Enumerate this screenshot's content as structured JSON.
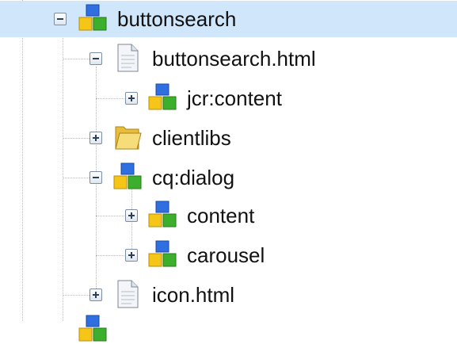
{
  "tree": {
    "nodes": [
      {
        "label": "buttonsearch",
        "icon": "node-icon",
        "expander": "collapse",
        "selected": true
      },
      {
        "label": "buttonsearch.html",
        "icon": "file-icon",
        "expander": "collapse"
      },
      {
        "label": "jcr:content",
        "icon": "node-icon",
        "expander": "expand"
      },
      {
        "label": "clientlibs",
        "icon": "folder-icon",
        "expander": "expand"
      },
      {
        "label": "cq:dialog",
        "icon": "node-icon",
        "expander": "collapse"
      },
      {
        "label": "content",
        "icon": "node-icon",
        "expander": "expand"
      },
      {
        "label": "carousel",
        "icon": "node-icon",
        "expander": "expand"
      },
      {
        "label": "icon.html",
        "icon": "file-icon",
        "expander": "expand"
      }
    ]
  },
  "colors": {
    "selection": "#cfe6fb",
    "guide_lines": "#b9b9b9",
    "cube_blue": "#2f6fe0",
    "cube_yellow": "#f5c518",
    "cube_green": "#3cb02c",
    "folder": "#f2cf55"
  }
}
